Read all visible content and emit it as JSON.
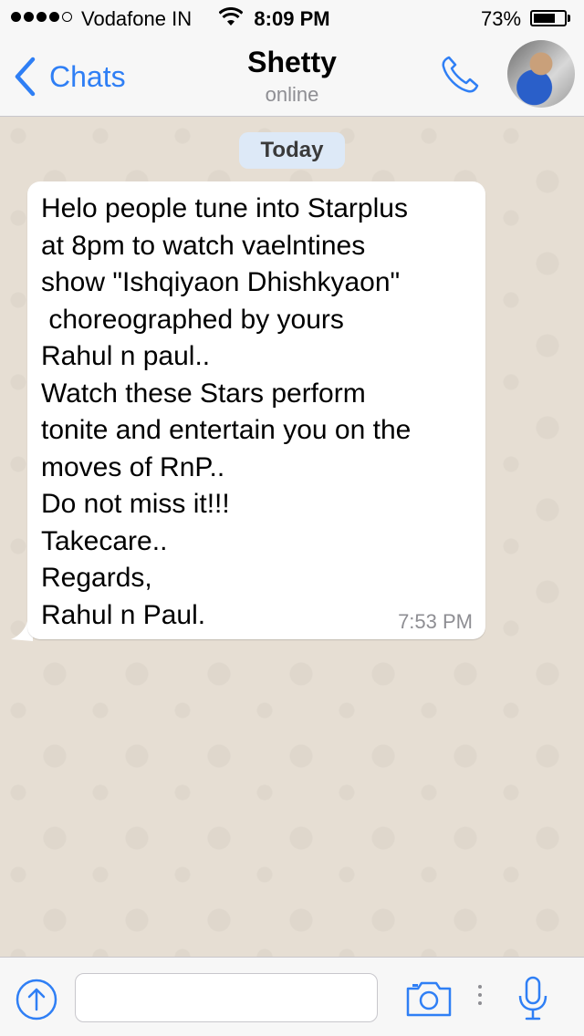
{
  "status_bar": {
    "signal_bars": 4,
    "signal_total": 5,
    "carrier": "Vodafone IN",
    "time": "8:09 PM",
    "battery_percent": "73%",
    "battery_level": 0.73
  },
  "header": {
    "back_label": "Chats",
    "title": "Shetty",
    "subtitle": "online",
    "call_icon": "phone-icon",
    "accent_color": "#2f7ff5"
  },
  "chat": {
    "date_label": "Today",
    "messages": [
      {
        "direction": "incoming",
        "text": "Helo people tune into Starplus\nat 8pm to watch vaelntines\nshow \"Ishqiyaon Dhishkyaon\"\n choreographed by yours\nRahul n paul..\nWatch these Stars perform\ntonite and entertain you on the\nmoves of RnP..\nDo not miss it!!!\nTakecare..\nRegards,\nRahul n Paul.",
        "time": "7:53 PM"
      }
    ]
  },
  "input_bar": {
    "share_icon": "arrow-up-circle-icon",
    "message_value": "",
    "camera_icon": "camera-icon",
    "mic_icon": "microphone-icon"
  }
}
